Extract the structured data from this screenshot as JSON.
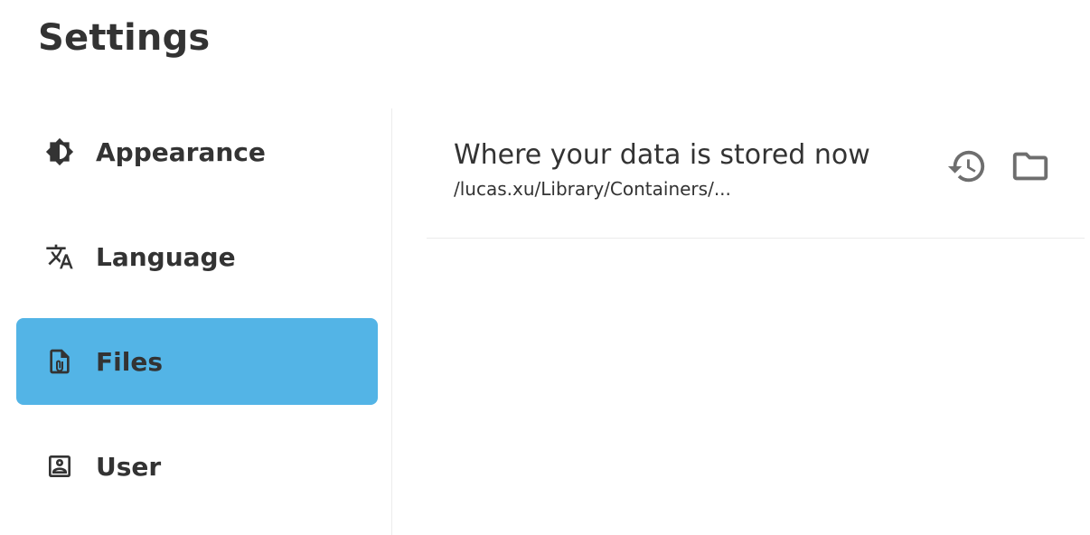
{
  "page": {
    "title": "Settings"
  },
  "sidebar": {
    "items": [
      {
        "label": "Appearance",
        "icon": "brightness-icon",
        "active": false
      },
      {
        "label": "Language",
        "icon": "translate-icon",
        "active": false
      },
      {
        "label": "Files",
        "icon": "file-attachment-icon",
        "active": true
      },
      {
        "label": "User",
        "icon": "account-box-icon",
        "active": false
      }
    ]
  },
  "files": {
    "storage_title": "Where your data is stored now",
    "storage_path": "/lucas.xu/Library/Containers/...",
    "actions": [
      "history-icon",
      "folder-icon"
    ]
  },
  "colors": {
    "active_item_bg": "#53b4e6",
    "text": "#333333",
    "icon_gray": "#6e6e6e",
    "divider": "#ececec"
  }
}
